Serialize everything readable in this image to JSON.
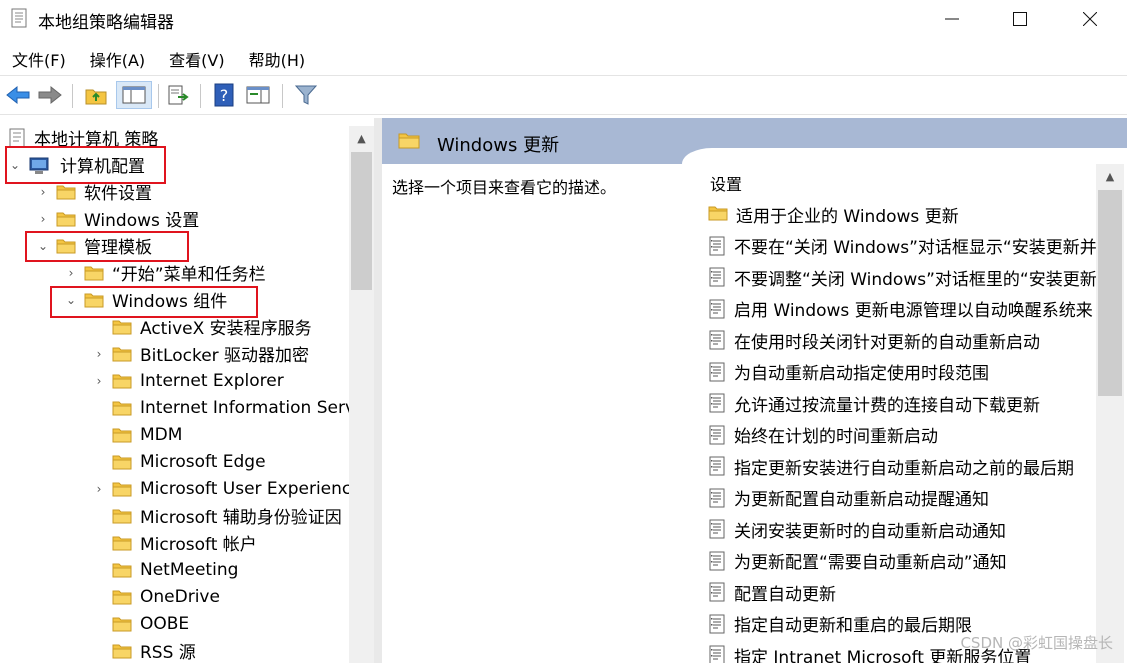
{
  "window": {
    "title": "本地组策略编辑器",
    "minimize": "—",
    "maximize": "☐",
    "close": "✕"
  },
  "menu": [
    "文件(F)",
    "操作(A)",
    "查看(V)",
    "帮助(H)"
  ],
  "toolbar_icons": [
    "back-icon",
    "forward-icon",
    "up-folder-icon",
    "show-hide-tree-icon",
    "export-list-icon",
    "help-icon",
    "properties-icon",
    "filter-icon"
  ],
  "tree": {
    "root": "本地计算机 策略",
    "items": [
      {
        "label": "计算机配置",
        "arrow": "⌄",
        "icon": "computer-icon"
      },
      {
        "label": "软件设置",
        "arrow": "›",
        "icon": "folder-icon"
      },
      {
        "label": "Windows 设置",
        "arrow": "›",
        "icon": "folder-icon"
      },
      {
        "label": "管理模板",
        "arrow": "⌄",
        "icon": "folder-icon"
      },
      {
        "label": "“开始”菜单和任务栏",
        "arrow": "›",
        "icon": "folder-icon"
      },
      {
        "label": "Windows 组件",
        "arrow": "⌄",
        "icon": "folder-icon"
      },
      {
        "label": "ActiveX 安装程序服务",
        "arrow": "",
        "icon": "folder-icon"
      },
      {
        "label": "BitLocker 驱动器加密",
        "arrow": "›",
        "icon": "folder-icon"
      },
      {
        "label": "Internet Explorer",
        "arrow": "›",
        "icon": "folder-icon"
      },
      {
        "label": "Internet Information Serv",
        "arrow": "",
        "icon": "folder-icon"
      },
      {
        "label": "MDM",
        "arrow": "",
        "icon": "folder-icon"
      },
      {
        "label": "Microsoft Edge",
        "arrow": "",
        "icon": "folder-icon"
      },
      {
        "label": "Microsoft User Experienc",
        "arrow": "›",
        "icon": "folder-icon"
      },
      {
        "label": "Microsoft 辅助身份验证因",
        "arrow": "",
        "icon": "folder-icon"
      },
      {
        "label": "Microsoft 帐户",
        "arrow": "",
        "icon": "folder-icon"
      },
      {
        "label": "NetMeeting",
        "arrow": "",
        "icon": "folder-icon"
      },
      {
        "label": "OneDrive",
        "arrow": "",
        "icon": "folder-icon"
      },
      {
        "label": "OOBE",
        "arrow": "",
        "icon": "folder-icon"
      },
      {
        "label": "RSS 源",
        "arrow": "",
        "icon": "folder-icon"
      }
    ]
  },
  "right": {
    "header_title": "Windows 更新",
    "description": "选择一个项目来查看它的描述。",
    "column_header": "设置",
    "settings": [
      {
        "label": "适用于企业的 Windows 更新",
        "icon": "folder-icon"
      },
      {
        "label": "不要在“关闭 Windows”对话框显示“安装更新并",
        "icon": "policy-doc-icon"
      },
      {
        "label": "不要调整“关闭 Windows”对话框里的“安装更新",
        "icon": "policy-doc-icon"
      },
      {
        "label": "启用 Windows 更新电源管理以自动唤醒系统来",
        "icon": "policy-doc-icon"
      },
      {
        "label": "在使用时段关闭针对更新的自动重新启动",
        "icon": "policy-doc-icon"
      },
      {
        "label": "为自动重新启动指定使用时段范围",
        "icon": "policy-doc-icon"
      },
      {
        "label": "允许通过按流量计费的连接自动下载更新",
        "icon": "policy-doc-icon"
      },
      {
        "label": "始终在计划的时间重新启动",
        "icon": "policy-doc-icon"
      },
      {
        "label": "指定更新安装进行自动重新启动之前的最后期",
        "icon": "policy-doc-icon"
      },
      {
        "label": "为更新配置自动重新启动提醒通知",
        "icon": "policy-doc-icon"
      },
      {
        "label": "关闭安装更新时的自动重新启动通知",
        "icon": "policy-doc-icon"
      },
      {
        "label": "为更新配置“需要自动重新启动”通知",
        "icon": "policy-doc-icon"
      },
      {
        "label": "配置自动更新",
        "icon": "policy-doc-icon"
      },
      {
        "label": "指定自动更新和重启的最后期限",
        "icon": "policy-doc-icon"
      },
      {
        "label": "指定 Intranet Microsoft 更新服务位置",
        "icon": "policy-doc-icon"
      }
    ]
  },
  "watermark": "CSDN @彩虹国操盘长",
  "colors": {
    "highlight_box": "#e0141e",
    "header_band": "#a8b8d4",
    "folder": "#f4c542"
  }
}
